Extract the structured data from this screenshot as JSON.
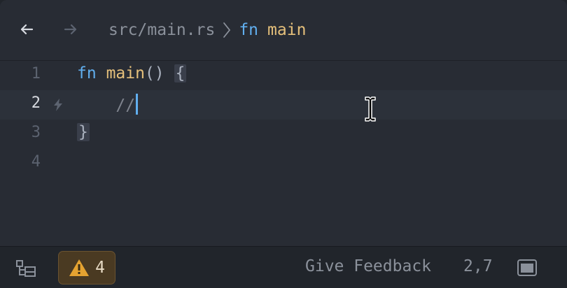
{
  "breadcrumb": {
    "path": "src/main.rs",
    "symbol_kind": "fn",
    "symbol_name": "main"
  },
  "editor": {
    "lines": [
      {
        "number": "1",
        "kw": "fn",
        "name": "main",
        "rest": "() ",
        "brace": "{"
      },
      {
        "number": "2",
        "indent": "    ",
        "comment": "//"
      },
      {
        "number": "3",
        "brace": "}"
      },
      {
        "number": "4"
      }
    ],
    "active_line": "2"
  },
  "statusbar": {
    "diagnostics_count": "4",
    "feedback_label": "Give Feedback",
    "cursor_position": "2,7"
  },
  "colors": {
    "keyword": "#61afef",
    "function": "#e5c07b",
    "caret": "#61afef",
    "warning": "#e5a331"
  },
  "icons": [
    "back-arrow-icon",
    "forward-arrow-icon",
    "chevron-right-icon",
    "lightning-icon",
    "ibeam-cursor-icon",
    "outline-icon",
    "warning-icon",
    "panel-icon"
  ]
}
